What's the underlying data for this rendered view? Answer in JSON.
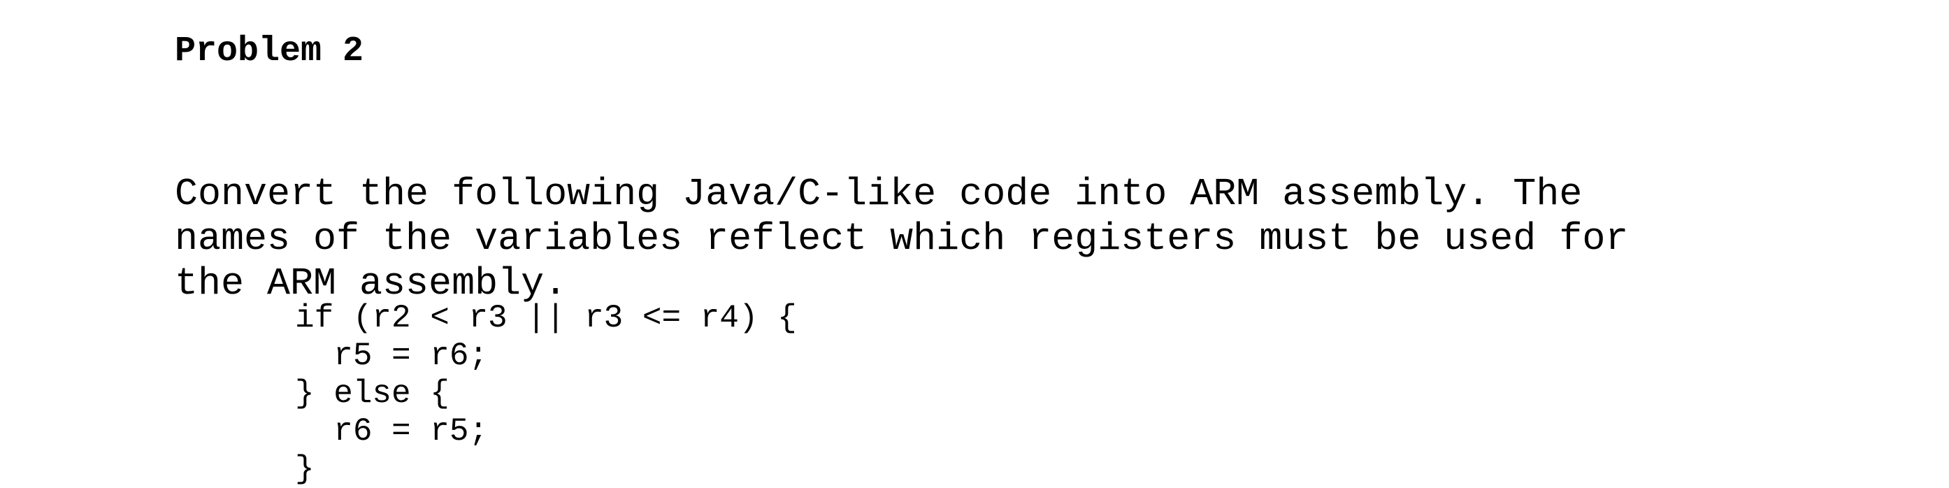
{
  "problem": {
    "title": "Problem 2",
    "description_lines": [
      "Convert the following Java/C-like code into ARM assembly. The",
      "names of the variables reflect which registers must be used for",
      "the ARM assembly."
    ],
    "code_lines": [
      "if (r2 < r3 || r3 <= r4) {",
      "  r5 = r6;",
      "} else {",
      "  r6 = r5;",
      "}"
    ]
  }
}
